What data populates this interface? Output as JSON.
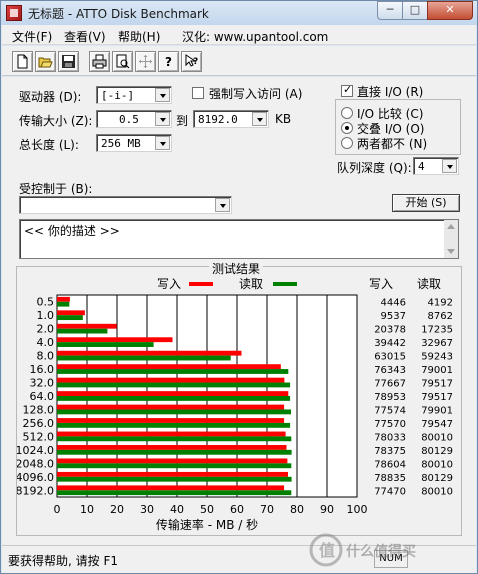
{
  "window": {
    "title": "无标题 - ATTO Disk Benchmark",
    "minimize_glyph": "─",
    "maximize_glyph": "□",
    "close_glyph": "✕"
  },
  "menu": {
    "items": [
      {
        "label": "文件(F)"
      },
      {
        "label": "查看(V)"
      },
      {
        "label": "帮助(H)"
      },
      {
        "label": "汉化: www.upantool.com"
      }
    ]
  },
  "toolbar": {
    "icons": [
      "new-file-icon",
      "open-folder-icon",
      "save-icon",
      "print-icon",
      "print-preview-icon",
      "move-icon",
      "help-icon",
      "context-help-icon"
    ]
  },
  "settings": {
    "drive_label": "驱动器 (D):",
    "drive_value": "[-i-]",
    "force_write_label": "强制写入访问 (A)",
    "transfer_size_label": "传输大小 (Z):",
    "transfer_from": "0.5",
    "transfer_to_label": "到",
    "transfer_to": "8192.0",
    "transfer_unit": "KB",
    "total_length_label": "总长度 (L):",
    "total_length_value": "256 MB",
    "direct_io_label": "直接 I/O (R)",
    "io_compare_label": "I/O 比较 (C)",
    "overlapped_io_label": "交叠 I/O (O)",
    "neither_label": "两者都不 (N)",
    "queue_depth_label": "队列深度 (Q):",
    "queue_depth_value": "4",
    "controlled_by_label": "受控制于 (B):",
    "controlled_by_value": "",
    "start_button": "开始 (S)",
    "description": "<<  你的描述   >>"
  },
  "results": {
    "title": "测试结果",
    "legend_write": "写入",
    "legend_read": "读取",
    "col_write": "写入",
    "col_read": "读取",
    "x_axis_label": "传输速率 - MB / 秒",
    "write_color": "#ff0000",
    "read_color": "#008000"
  },
  "chart_data": {
    "type": "bar",
    "orientation": "horizontal",
    "title": "测试结果",
    "xlabel": "传输速率 - MB / 秒",
    "xlim": [
      0,
      100
    ],
    "xticks": [
      0,
      10,
      20,
      30,
      40,
      50,
      60,
      70,
      80,
      90,
      100
    ],
    "grid": true,
    "legend": "top",
    "categories": [
      "0.5",
      "1.0",
      "2.0",
      "4.0",
      "8.0",
      "16.0",
      "32.0",
      "64.0",
      "128.0",
      "256.0",
      "512.0",
      "1024.0",
      "2048.0",
      "4096.0",
      "8192.0"
    ],
    "series": [
      {
        "name": "写入",
        "color": "#ff0000",
        "values": [
          4.3,
          9.3,
          19.9,
          38.5,
          61.5,
          74.6,
          75.8,
          77.1,
          75.7,
          75.7,
          76.2,
          76.5,
          76.8,
          77.0,
          75.7
        ]
      },
      {
        "name": "读取",
        "color": "#008000",
        "values": [
          4.1,
          8.6,
          16.8,
          32.2,
          57.9,
          77.1,
          77.7,
          77.7,
          78.0,
          77.7,
          78.1,
          78.2,
          78.1,
          78.2,
          78.1
        ]
      }
    ],
    "table": {
      "write": [
        "4446",
        "9537",
        "20378",
        "39442",
        "63015",
        "76343",
        "77667",
        "78953",
        "77574",
        "77570",
        "78033",
        "78375",
        "78604",
        "78835",
        "77470"
      ],
      "read": [
        "4192",
        "8762",
        "17235",
        "32967",
        "59243",
        "79001",
        "79517",
        "79517",
        "79901",
        "79547",
        "80010",
        "80129",
        "80010",
        "80129",
        "80010"
      ]
    }
  },
  "status": {
    "help_text": "要获得帮助, 请按 F1",
    "pane_text": "NUM"
  },
  "watermark": {
    "text": "什么值得买"
  }
}
